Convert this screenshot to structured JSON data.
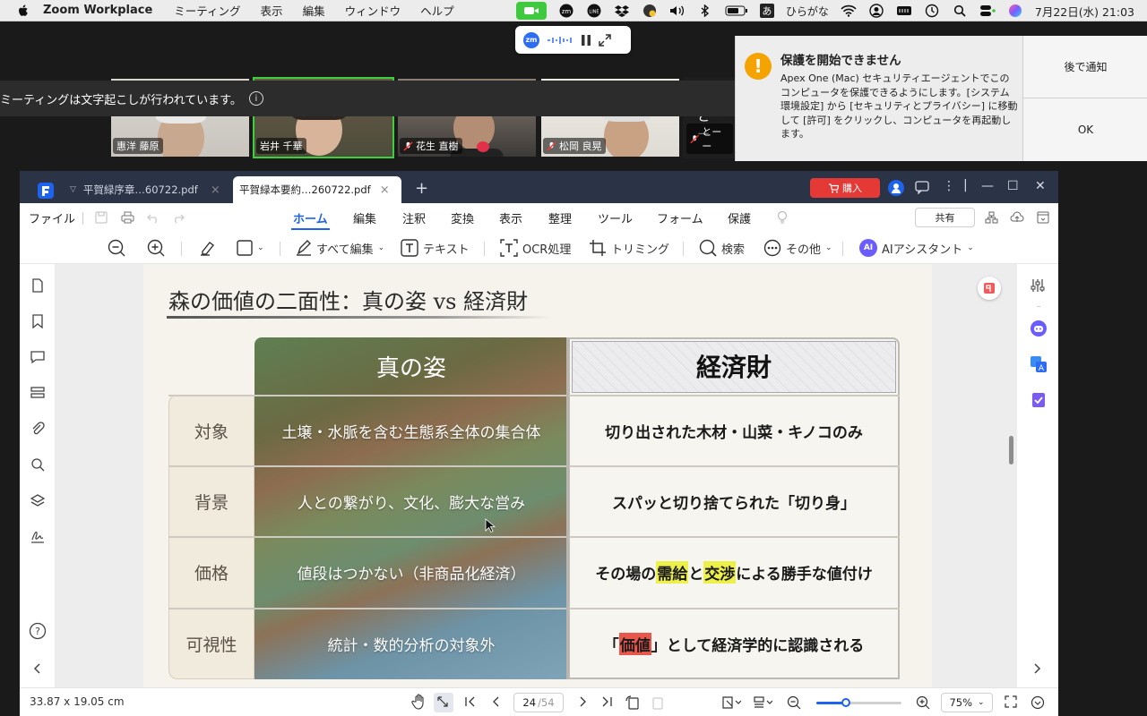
{
  "menubar": {
    "app_name": "Zoom Workplace",
    "menus": [
      "ミーティング",
      "表示",
      "編集",
      "ウィンドウ",
      "ヘルプ"
    ],
    "ime_char": "あ",
    "ime_mode": "ひらがな",
    "datetime": "7月22日(水)  21:03",
    "status_icons": [
      "zoom-camera-icon",
      "zoom-icon",
      "line-icon",
      "dropbox-icon",
      "user-status-icon",
      "volume-icon",
      "bluetooth-icon",
      "battery-icon",
      "ime-icon",
      "wifi-icon",
      "user-icon",
      "keyboard-icon",
      "time-machine-icon",
      "spotlight-icon",
      "control-center-icon",
      "siri-icon"
    ]
  },
  "zoom": {
    "pill_badge": "zm",
    "transcription_notice": "ミーティングは文字起こしが行われています。",
    "info_glyph": "i",
    "participants": [
      {
        "name": "惠洋 藤原",
        "muted": false,
        "active": false
      },
      {
        "name": "岩井 千華",
        "muted": false,
        "active": true
      },
      {
        "name": "花生 直樹",
        "muted": true,
        "active": false
      },
      {
        "name": "松岡 良晃",
        "muted": true,
        "active": false
      },
      {
        "name": "とーー",
        "muted": true,
        "active": false
      }
    ],
    "partial_tile_text": "とーー"
  },
  "alert": {
    "icon_glyph": "!",
    "title": "保護を開始できません",
    "body": "Apex One (Mac) セキュリティエージェントでこのコンピュータを保護できるようにします。[システム環境設定] から [セキュリティとプライバシー] に移動して [許可] をクリックし、コンピュータを再起動します。",
    "later_label": "後で通知",
    "ok_label": "OK"
  },
  "pdf": {
    "tabs": [
      {
        "label": "平賀緑序章…60722.pdf",
        "active": false
      },
      {
        "label": "平賀緑本要約…260722.pdf",
        "active": true
      }
    ],
    "close_glyph": "×",
    "new_tab_glyph": "+",
    "buy_label": "購入",
    "window_glyphs": {
      "menu": "⋮",
      "minimize": "—",
      "maximize": "☐",
      "close": "✕"
    },
    "file_menu": "ファイル",
    "menu_tabs": [
      "ホーム",
      "編集",
      "注釈",
      "変換",
      "表示",
      "整理",
      "ツール",
      "フォーム",
      "保護"
    ],
    "selected_menu_tab": "ホーム",
    "share_label": "共有",
    "tools": {
      "edit_all": "すべて編集",
      "text": "テキスト",
      "ocr": "OCR処理",
      "crop": "トリミング",
      "search": "検索",
      "more": "その他",
      "ai": "AIアシスタント",
      "ai_badge": "AI"
    },
    "status": {
      "page_size": "33.87 x 19.05 cm",
      "current_page": "24",
      "total_pages": "/54",
      "zoom": "75%",
      "zoom_fraction": 0.35
    }
  },
  "slide": {
    "title": "森の価値の二面性：真の姿 vs 経済財",
    "col_left": "真の姿",
    "col_right": "経済財",
    "rows": [
      {
        "label": "対象",
        "left": "土壌・水脈を含む生態系全体の集合体",
        "right_parts": [
          {
            "t": "切り出された木材・山菜・キノコのみ",
            "hl": ""
          }
        ]
      },
      {
        "label": "背景",
        "left": "人との繋がり、文化、膨大な営み",
        "right_parts": [
          {
            "t": "スパッと切り捨てられた「切り身」",
            "hl": ""
          }
        ]
      },
      {
        "label": "価格",
        "left": "値段はつかない（非商品化経済）",
        "right_parts": [
          {
            "t": "その場の",
            "hl": ""
          },
          {
            "t": "需給",
            "hl": "yellow"
          },
          {
            "t": "と",
            "hl": ""
          },
          {
            "t": "交渉",
            "hl": "yellow"
          },
          {
            "t": "による勝手な値付け",
            "hl": ""
          }
        ]
      },
      {
        "label": "可視性",
        "left": "統計・数的分析の対象外",
        "right_parts": [
          {
            "t": "「",
            "hl": ""
          },
          {
            "t": "価値",
            "hl": "red"
          },
          {
            "t": "」として経済学的に認識される",
            "hl": ""
          }
        ]
      }
    ]
  }
}
